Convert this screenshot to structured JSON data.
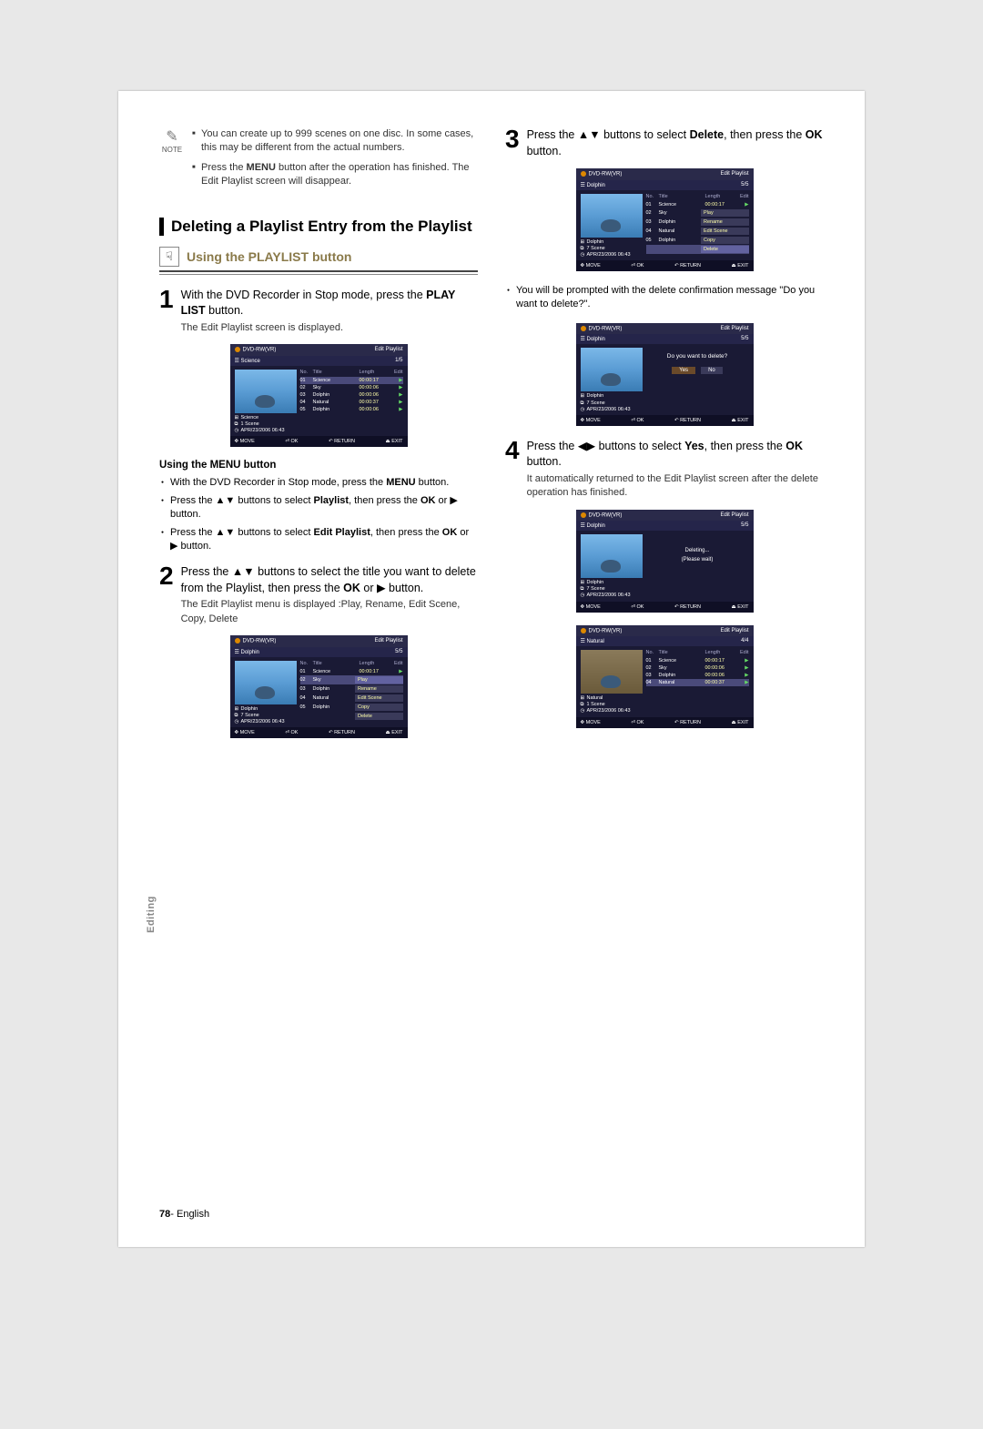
{
  "note_label": "NOTE",
  "notes": [
    "You can create up to 999 scenes on one disc. In some cases, this may be different from the actual numbers.",
    "Press the MENU button after the operation has finished. The Edit Playlist screen will disappear."
  ],
  "section_title": "Deleting a Playlist Entry from the Playlist",
  "sub_title": "Using the PLAYLIST button",
  "steps": {
    "s1": {
      "num": "1",
      "text_a": "With the DVD Recorder in Stop mode, press the ",
      "bold": "PLAY LIST",
      "text_b": " button.",
      "sub": "The Edit Playlist screen is displayed."
    },
    "s2": {
      "num": "2",
      "text_a": "Press the ",
      "bold_b": "OK",
      "text_b": " buttons to select the title you want to delete from the Playlist, then press the ",
      "text_c": " or ▶ button.",
      "sub": "The Edit Playlist menu is displayed :Play, Rename, Edit Scene, Copy, Delete"
    },
    "s3": {
      "num": "3",
      "text_a": "Press the ",
      "text_b": " buttons to select ",
      "bold_a": "Delete",
      "text_c": ", then press the ",
      "bold_b": "OK",
      "text_d": " button."
    },
    "s4": {
      "num": "4",
      "text_a": "Press the ",
      "text_b": " buttons to select ",
      "bold_a": "Yes",
      "text_c": ", then press the ",
      "bold_b": "OK",
      "text_d": " button.",
      "sub": "It automatically returned to the Edit Playlist screen after the delete operation has finished."
    }
  },
  "menu_subhead": "Using the MENU button",
  "menu_bullets": [
    "With the DVD Recorder in Stop mode, press the MENU button.",
    "Press the ▲▼ buttons to select Playlist, then press the OK or ▶ button.",
    "Press the ▲▼ buttons to select Edit Playlist, then press the OK or ▶ button."
  ],
  "right_bullets": [
    "You will be prompted with the delete confirmation message \"Do you want to delete?\"."
  ],
  "shots": {
    "common": {
      "disc": "DVD-RW(VR)",
      "header": "Edit Playlist",
      "cols": {
        "no": "No.",
        "title": "Title",
        "length": "Length",
        "edit": "Edit"
      },
      "footer": {
        "move": "MOVE",
        "ok": "OK",
        "return": "RETURN",
        "exit": "EXIT"
      },
      "info_date": "APR/23/2006 06:43"
    },
    "shot1": {
      "page": "1/5",
      "sub": "Science",
      "info_name": "Science",
      "info_scene": "1 Scene",
      "rows": [
        {
          "n": "01",
          "t": "Science",
          "l": "00:00:17"
        },
        {
          "n": "02",
          "t": "Sky",
          "l": "00:00:06"
        },
        {
          "n": "03",
          "t": "Dolphin",
          "l": "00:00:06"
        },
        {
          "n": "04",
          "t": "Natural",
          "l": "00:00:37"
        },
        {
          "n": "05",
          "t": "Dolphin",
          "l": "00:00:06"
        }
      ]
    },
    "shot2": {
      "page": "5/5",
      "sub": "Dolphin",
      "info_name": "Dolphin",
      "info_scene": "7 Scene",
      "menu": [
        "Play",
        "Rename",
        "Edit Scene",
        "Copy",
        "Delete"
      ],
      "rows": [
        {
          "n": "01",
          "t": "Science",
          "l": "00:00:17"
        },
        {
          "n": "02",
          "t": "Sky"
        },
        {
          "n": "03",
          "t": "Dolphin"
        },
        {
          "n": "04",
          "t": "Natural"
        },
        {
          "n": "05",
          "t": "Dolphin"
        }
      ]
    },
    "shot3": {
      "page": "5/5",
      "sub": "Dolphin",
      "info_name": "Dolphin",
      "info_scene": "7 Scene",
      "msg": "Do you want to delete?",
      "yes": "Yes",
      "no": "No"
    },
    "shot4": {
      "page": "5/5",
      "sub": "Dolphin",
      "info_name": "Dolphin",
      "info_scene": "7 Scene",
      "msg1": "Deleting...",
      "msg2": "(Please wait)"
    },
    "shot5": {
      "page": "4/4",
      "sub": "Natural",
      "info_name": "Natural",
      "info_scene": "1 Scene",
      "rows": [
        {
          "n": "01",
          "t": "Science",
          "l": "00:00:17"
        },
        {
          "n": "02",
          "t": "Sky",
          "l": "00:00:06"
        },
        {
          "n": "03",
          "t": "Dolphin",
          "l": "00:00:06"
        },
        {
          "n": "04",
          "t": "Natural",
          "l": "00:00:37"
        }
      ]
    }
  },
  "side_tab": "Editing",
  "page_number": "78",
  "page_lang": "English"
}
